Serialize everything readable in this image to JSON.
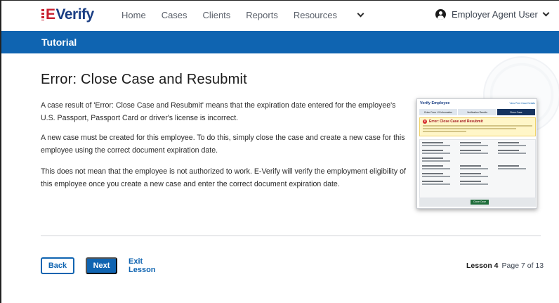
{
  "header": {
    "logo_prefix": "E",
    "logo_text": "Verify",
    "nav": [
      "Home",
      "Cases",
      "Clients",
      "Reports"
    ],
    "resources_label": "Resources",
    "user_label": "Employer Agent User"
  },
  "banner": {
    "title": "Tutorial"
  },
  "main": {
    "heading": "Error: Close Case and Resubmit",
    "paragraphs": [
      "A case result of 'Error: Close Case and Resubmit' means that the expiration date entered for the employee's U.S. Passport, Passport Card or driver's license is incorrect.",
      "A new case must be created for this employee. To do this, simply close the case and create a new case for this employee using the correct document expiration date.",
      "This does not mean that the employee is not authorized to work. E-Verify will verify the employment eligibility of this employee once you create a new case and enter the correct document expiration date."
    ]
  },
  "thumbnail": {
    "title": "Verify Employee",
    "view_link": "View Print Case Details",
    "steps": [
      "Enter Form I-9 Information",
      "Verification Results",
      "Close Case"
    ],
    "alert_title": "Error: Close Case and Resubmit",
    "close_button": "Close Case"
  },
  "footer": {
    "back_label": "Back",
    "next_label": "Next",
    "exit_label": "Exit Lesson",
    "lesson_label": "Lesson 4",
    "page_label": "Page 7 of 13"
  },
  "colors": {
    "brand_blue": "#0f64b1",
    "logo_navy": "#1a3e84",
    "logo_red": "#c8202f"
  }
}
